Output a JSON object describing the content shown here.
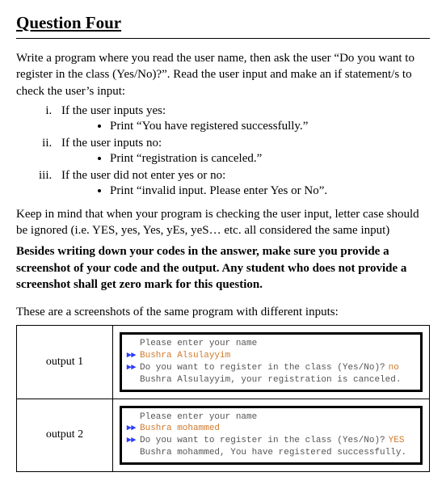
{
  "title": "Question Four",
  "intro": "Write a program where you read the user name, then ask the user “Do you want to register in the class (Yes/No)?”. Read the user input and make an if statement/s to check the user’s input:",
  "items": {
    "i": "If the user inputs yes:",
    "i_bullet": "Print “You have registered successfully.”",
    "ii": "If the user inputs no:",
    "ii_bullet": "Print “registration is canceled.”",
    "iii": "If the user did not enter yes or no:",
    "iii_bullet": "Print “invalid input. Please enter Yes or No”."
  },
  "note1": "Keep in mind that when your program is checking the user input, letter case should be ignored (i.e. YES, yes, Yes, yEs, yeS… etc. all considered the same input)",
  "note2": "Besides writing down your codes in the answer, make sure you provide a screenshot of your code and the output.  Any student who does not provide a screenshot shall get zero mark for this question.",
  "screenshots_intro": "These are a screenshots of the same program with different inputs:",
  "outputs": {
    "o1_label": "output 1",
    "o2_label": "output 2",
    "prompt_name": "Please enter your name",
    "prompt_reg": "Do you want to register in the class (Yes/No)?",
    "o1_name": "Bushra Alsulayyim",
    "o1_answer": "no",
    "o1_result": "Bushra Alsulayyim, your registration is canceled.",
    "o2_name": "Bushra mohammed",
    "o2_answer": "YES",
    "o2_result": "Bushra mohammed, You have registered successfully."
  }
}
